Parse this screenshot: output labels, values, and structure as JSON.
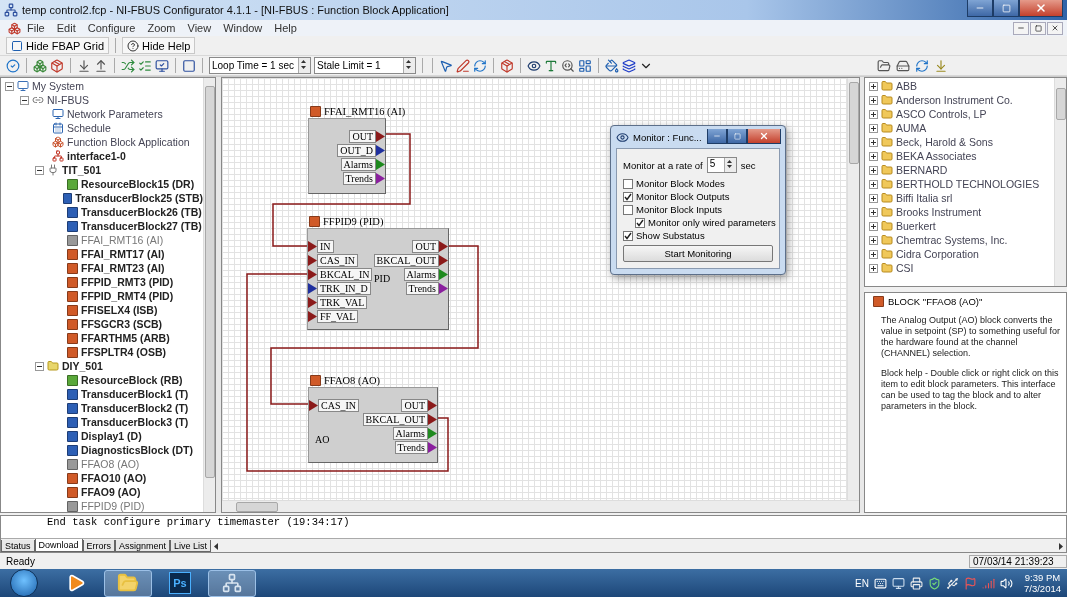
{
  "window": {
    "title": "temp control2.fcp - NI-FBUS Configurator 4.1.1 - [NI-FBUS : Function Block Application]"
  },
  "menu": [
    "File",
    "Edit",
    "Configure",
    "Zoom",
    "View",
    "Window",
    "Help"
  ],
  "toolbar_toggles": [
    "Hide FBAP Grid",
    "Hide Help"
  ],
  "toolbar": {
    "loop_time": "Loop Time = 1 sec",
    "stale_limit": "Stale Limit = 1"
  },
  "tree": [
    {
      "label": "My System",
      "kind": "system",
      "expanded": true,
      "children": [
        {
          "label": "NI-FBUS",
          "kind": "link",
          "expanded": true,
          "children": [
            {
              "label": "Network Parameters",
              "kind": "params"
            },
            {
              "label": "Schedule",
              "kind": "schedule"
            },
            {
              "label": "Function Block Application",
              "kind": "fbap"
            },
            {
              "label": "interface1-0",
              "kind": "interface"
            },
            {
              "label": "TIT_501",
              "kind": "device",
              "expanded": true,
              "children": [
                {
                  "label": "ResourceBlock15 (DR)",
                  "kind": "resource"
                },
                {
                  "label": "TransducerBlock25 (STB)",
                  "kind": "transducer"
                },
                {
                  "label": "TransducerBlock26 (TB)",
                  "kind": "transducer"
                },
                {
                  "label": "TransducerBlock27 (TB)",
                  "kind": "transducer"
                },
                {
                  "label": "FFAI_RMT16 (AI)",
                  "kind": "block-unused"
                },
                {
                  "label": "FFAI_RMT17 (AI)",
                  "kind": "block"
                },
                {
                  "label": "FFAI_RMT23 (AI)",
                  "kind": "block"
                },
                {
                  "label": "FFPID_RMT3 (PID)",
                  "kind": "block"
                },
                {
                  "label": "FFPID_RMT4 (PID)",
                  "kind": "block"
                },
                {
                  "label": "FFISELX4 (ISB)",
                  "kind": "block"
                },
                {
                  "label": "FFSGCR3 (SCB)",
                  "kind": "block"
                },
                {
                  "label": "FFARTHM5 (ARB)",
                  "kind": "block"
                },
                {
                  "label": "FFSPLTR4 (OSB)",
                  "kind": "block"
                }
              ]
            },
            {
              "label": "DIY_501",
              "kind": "device-folder",
              "expanded": true,
              "children": [
                {
                  "label": "ResourceBlock (RB)",
                  "kind": "resource"
                },
                {
                  "label": "TransducerBlock1 (T)",
                  "kind": "transducer"
                },
                {
                  "label": "TransducerBlock2 (T)",
                  "kind": "transducer"
                },
                {
                  "label": "TransducerBlock3 (T)",
                  "kind": "transducer"
                },
                {
                  "label": "Display1 (D)",
                  "kind": "transducer"
                },
                {
                  "label": "DiagnosticsBlock (DT)",
                  "kind": "transducer"
                },
                {
                  "label": "FFAO8 (AO)",
                  "kind": "block-unused"
                },
                {
                  "label": "FFAO10 (AO)",
                  "kind": "block"
                },
                {
                  "label": "FFAO9 (AO)",
                  "kind": "block"
                },
                {
                  "label": "FFPID9 (PID)",
                  "kind": "block-unused"
                }
              ]
            }
          ]
        }
      ]
    }
  ],
  "canvas": {
    "blocks": [
      {
        "title": "FFAI_RMT16 (AI)",
        "outputs": [
          {
            "label": "OUT",
            "color": "#8b1a1a"
          },
          {
            "label": "OUT_D",
            "color": "#1f2f9e"
          },
          {
            "label": "Alarms",
            "color": "#1f8a1f"
          },
          {
            "label": "Trends",
            "color": "#8a1f9e"
          }
        ]
      },
      {
        "title": "FFPID9 (PID)",
        "type_label": "PID",
        "inputs": [
          {
            "label": "IN",
            "color": "#8b1a1a"
          },
          {
            "label": "CAS_IN",
            "color": "#8b1a1a"
          },
          {
            "label": "BKCAL_IN",
            "color": "#8b1a1a"
          },
          {
            "label": "TRK_IN_D",
            "color": "#1f2f9e"
          },
          {
            "label": "TRK_VAL",
            "color": "#8b1a1a"
          },
          {
            "label": "FF_VAL",
            "color": "#8b1a1a"
          }
        ],
        "outputs": [
          {
            "label": "OUT",
            "color": "#8b1a1a"
          },
          {
            "label": "BKCAL_OUT",
            "color": "#8b1a1a"
          },
          {
            "label": "Alarms",
            "color": "#1f8a1f"
          },
          {
            "label": "Trends",
            "color": "#8a1f9e"
          }
        ]
      },
      {
        "title": "FFAO8 (AO)",
        "type_label": "AO",
        "inputs": [
          {
            "label": "CAS_IN",
            "color": "#8b1a1a"
          }
        ],
        "outputs": [
          {
            "label": "OUT",
            "color": "#8b1a1a"
          },
          {
            "label": "BKCAL_OUT",
            "color": "#8b1a1a"
          },
          {
            "label": "Alarms",
            "color": "#1f8a1f"
          },
          {
            "label": "Trends",
            "color": "#8a1f9e"
          }
        ]
      }
    ]
  },
  "monitor": {
    "title": "Monitor : Func...",
    "rate_label": "Monitor at a rate of",
    "rate": "5",
    "unit": "sec",
    "options": [
      {
        "label": "Monitor Block Modes",
        "checked": false
      },
      {
        "label": "Monitor Block Outputs",
        "checked": true
      },
      {
        "label": "Monitor Block Inputs",
        "checked": false,
        "children": [
          {
            "label": "Monitor only wired parameters",
            "checked": true
          }
        ]
      },
      {
        "label": "Show Substatus",
        "checked": true
      }
    ],
    "button": "Start Monitoring"
  },
  "vendors": [
    {
      "label": "ABB",
      "expanded": false
    },
    {
      "label": "Anderson Instrument Co.",
      "expanded": false
    },
    {
      "label": "ASCO Controls, LP",
      "expanded": false
    },
    {
      "label": "AUMA",
      "expanded": false
    },
    {
      "label": "Beck, Harold & Sons",
      "expanded": false
    },
    {
      "label": "BEKA Associates",
      "expanded": false
    },
    {
      "label": "BERNARD",
      "expanded": false
    },
    {
      "label": "BERTHOLD TECHNOLOGIES",
      "expanded": false
    },
    {
      "label": "Biffi Italia srl",
      "expanded": false
    },
    {
      "label": "Brooks Instrument",
      "expanded": false
    },
    {
      "label": "Buerkert",
      "expanded": false
    },
    {
      "label": "Chemtrac Systems, Inc.",
      "expanded": false
    },
    {
      "label": "Cidra Corporation",
      "expanded": false
    },
    {
      "label": "CSI",
      "expanded": false
    }
  ],
  "help": {
    "title": "BLOCK \"FFAO8 (AO)\"",
    "paragraphs": [
      "The Analog Output (AO) block converts the value in setpoint (SP) to something useful for the hardware found at the channel (CHANNEL) selection.",
      "Block help - Double click or right click on this item to edit block parameters.  This interface can be used to tag the block and to alter parameters in the block."
    ]
  },
  "log": {
    "lines": [
      "End task configure primary timemaster  (19:34:17)"
    ],
    "tabs": [
      {
        "label": "Status",
        "selected": false
      },
      {
        "label": "Download",
        "selected": true
      },
      {
        "label": "Errors",
        "selected": false
      },
      {
        "label": "Assignment",
        "selected": false
      },
      {
        "label": "Live List",
        "selected": false
      }
    ]
  },
  "status_bar": {
    "message": "Ready",
    "datetime": "07/03/14 21:39:23"
  },
  "taskbar": {
    "apps": [
      {
        "kind": "media",
        "running": false
      },
      {
        "kind": "explorer",
        "running": true
      },
      {
        "kind": "photoshop",
        "label": "Ps",
        "running": false
      },
      {
        "kind": "fbus",
        "running": true
      }
    ],
    "language": "EN",
    "time": "9:39 PM",
    "date": "7/3/2014"
  }
}
